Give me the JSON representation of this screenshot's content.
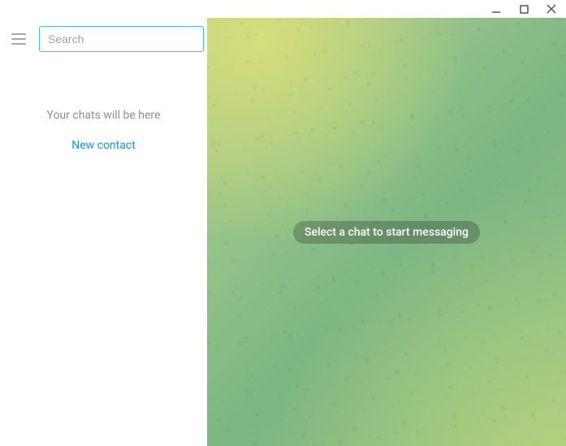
{
  "window": {
    "minimize_icon": "minimize",
    "maximize_icon": "maximize",
    "close_icon": "close"
  },
  "sidebar": {
    "search_placeholder": "Search",
    "empty_text": "Your chats will be here",
    "new_contact_label": "New contact"
  },
  "chat": {
    "prompt": "Select a chat to start messaging"
  }
}
